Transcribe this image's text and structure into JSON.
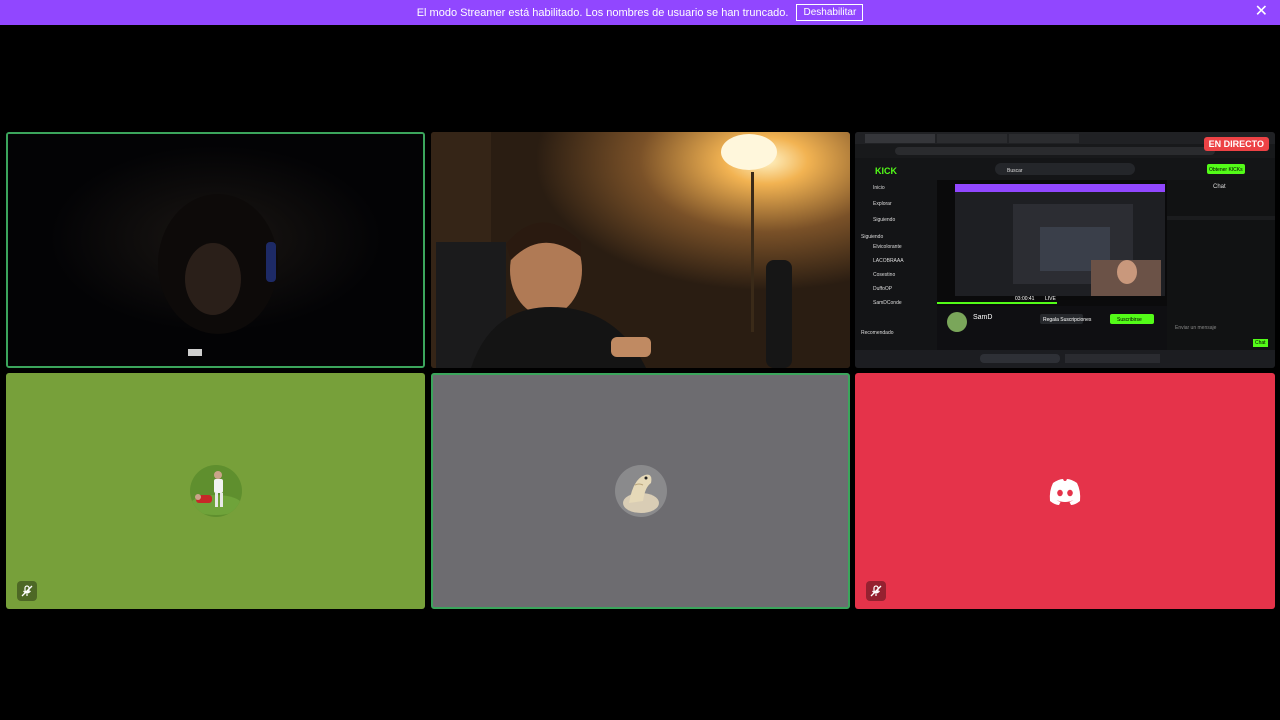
{
  "banner": {
    "message": "El modo Streamer está habilitado. Los nombres de usuario se han truncado.",
    "disable_label": "Deshabilitar",
    "close_glyph": "✕"
  },
  "screen_share": {
    "live_badge": "EN DIRECTO",
    "kick_logo": "KICK",
    "search_placeholder": "Buscar",
    "nav": [
      "Inicio",
      "Explorar",
      "Siguiendo"
    ],
    "followed_header": "Siguiendo",
    "followed": [
      "Elvicolorante",
      "LACOBRAAA",
      "Cosestino",
      "DuffoOP",
      "SamDConde"
    ],
    "recommended_header": "Recomendado",
    "chat_header": "Chat",
    "chat_placeholder": "Enviar un mensaje",
    "chat_button": "Chat",
    "time": "03:00:41",
    "live_label": "LIVE",
    "gift_button": "Regala Suscripciones",
    "subscribe_button": "Suscribirse",
    "kicks_button": "Obtener KICKs",
    "streamer": "SamD"
  },
  "colors": {
    "banner": "#9147ff",
    "speaking": "#3ba55c",
    "tile_green": "#77a03a",
    "tile_gray": "#6d6c70",
    "tile_red": "#e5334a",
    "kick_green": "#53fc18"
  },
  "icons": {
    "tile4_mute": "mic-muted-icon",
    "tile6_mute": "mic-muted-icon",
    "tile6_avatar": "discord-logo-icon"
  }
}
